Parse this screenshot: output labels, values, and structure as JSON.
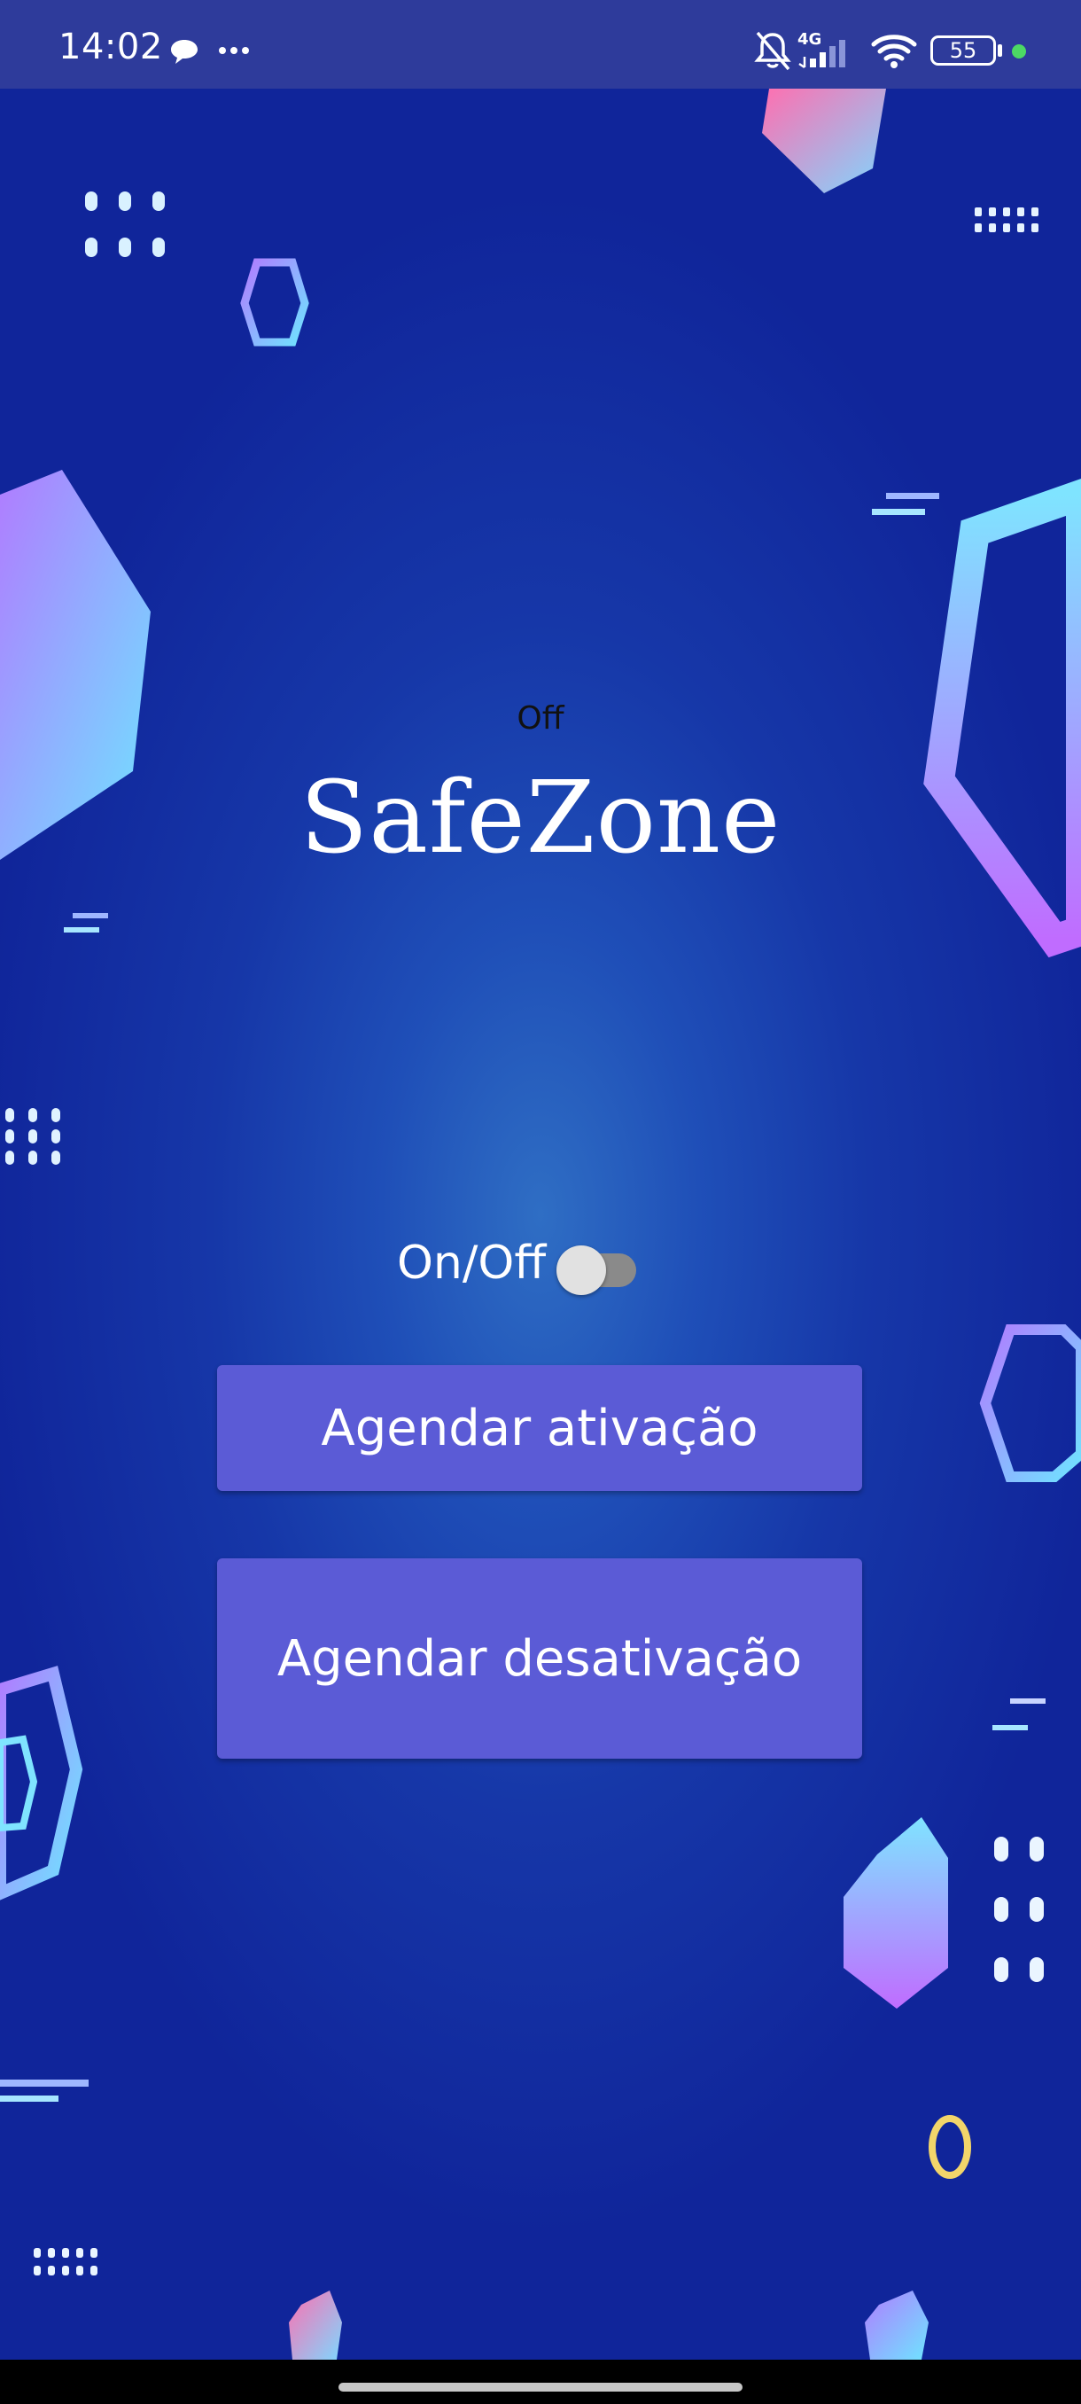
{
  "statusbar": {
    "time": "14:02",
    "icons": [
      "chat-bubble-icon",
      "more-dots-icon",
      "bell-muted-icon",
      "signal-4g-icon",
      "wifi-icon",
      "battery-icon",
      "active-dot-icon"
    ],
    "network": "4G",
    "battery_level": "55",
    "dot_color": "#4cd964"
  },
  "main": {
    "status_text": "Off",
    "title": "SafeZone",
    "toggle": {
      "label": "On/Off",
      "checked": false
    },
    "buttons": {
      "activate": "Agendar ativação",
      "deactivate": "Agendar desativação"
    }
  },
  "colors": {
    "statusbar_bg": "#2e3b9b",
    "button_bg": "#5b5bd6",
    "background_center": "#2f6ec4",
    "background_edge": "#10259a"
  }
}
